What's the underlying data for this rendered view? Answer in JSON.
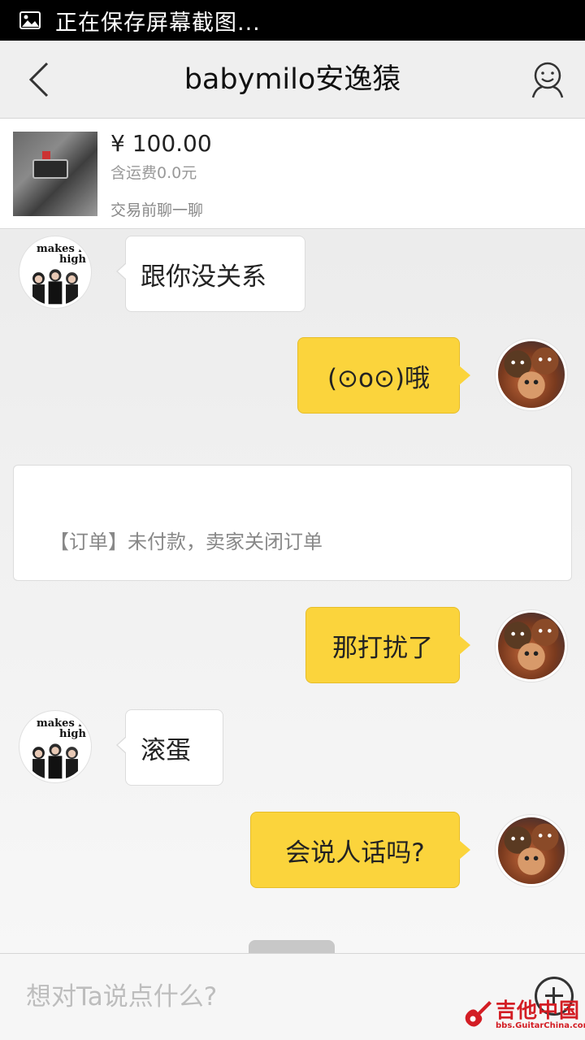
{
  "status_bar": {
    "text": "正在保存屏幕截图..."
  },
  "nav": {
    "title": "babymilo安逸猿"
  },
  "product": {
    "price": "¥ 100.00",
    "shipping": "含运费0.0元",
    "note": "交易前聊一聊"
  },
  "messages": [
    {
      "side": "left",
      "text": "跟你没关系"
    },
    {
      "side": "right",
      "text": "(⊙o⊙)哦"
    },
    {
      "side": "right",
      "text": "那打扰了"
    },
    {
      "side": "left",
      "text": "滚蛋"
    },
    {
      "side": "right",
      "text": "会说人话吗?"
    }
  ],
  "system_message": "【订单】未付款，卖家关闭订单",
  "avatar_other": {
    "line1": "makes h",
    "line2": "high"
  },
  "input": {
    "placeholder": "想对Ta说点什么?"
  },
  "watermark": {
    "title": "吉他中国",
    "url": "bbs.GuitarChina.com"
  },
  "colors": {
    "bubble_self": "#fbd43c",
    "bubble_other": "#ffffff",
    "watermark": "#d31d24"
  },
  "icons": [
    "image-icon",
    "back-icon",
    "profile-icon",
    "plus-icon",
    "guitar-logo-icon"
  ]
}
